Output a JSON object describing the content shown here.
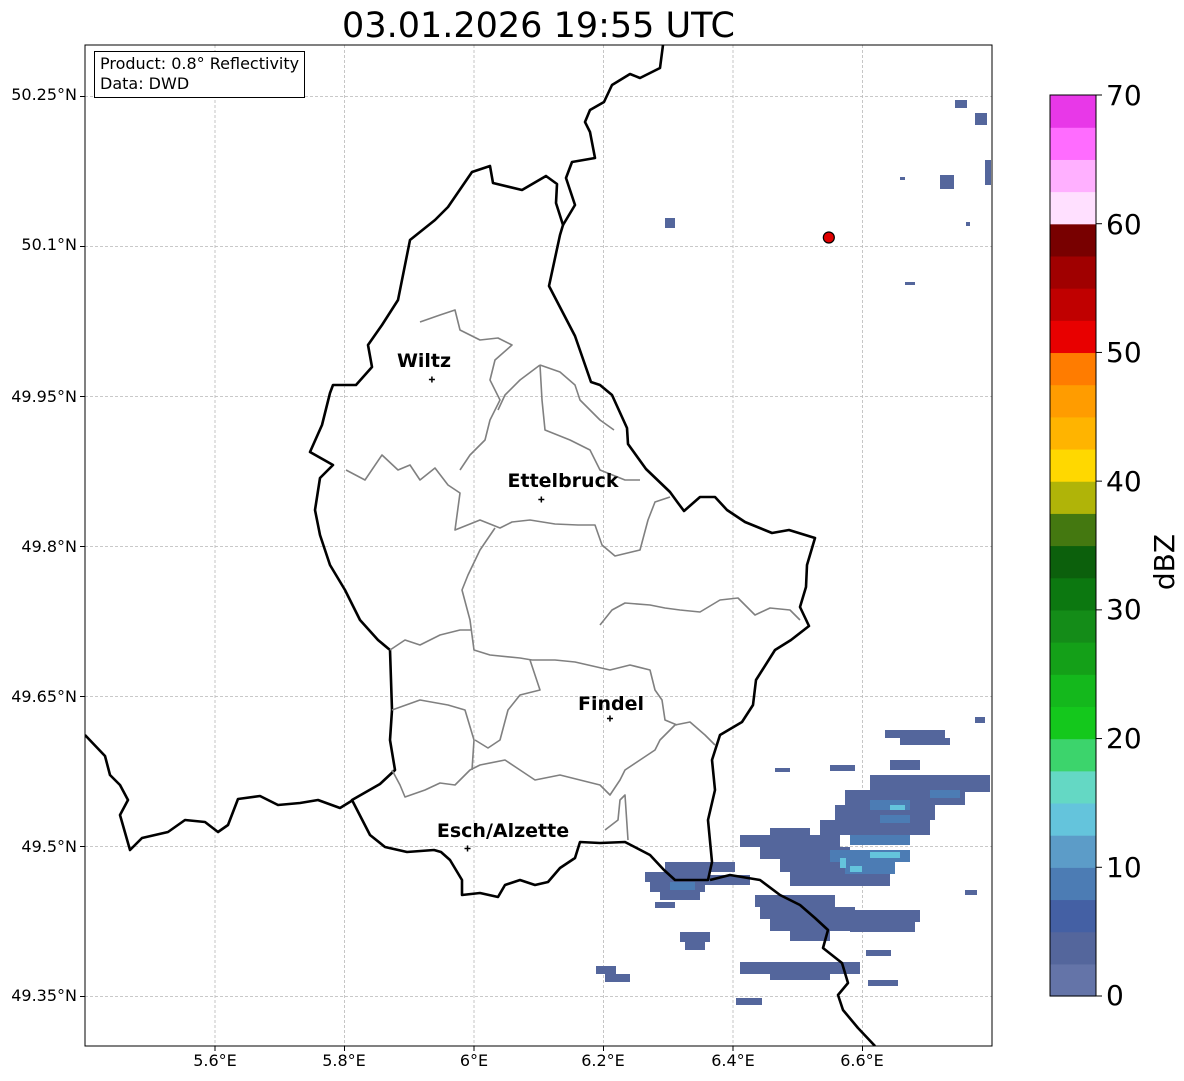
{
  "title": "03.01.2026 19:55 UTC",
  "info_box": {
    "product": "Product: 0.8° Reflectivity",
    "source": "Data: DWD"
  },
  "axes": {
    "lat_ticks": [
      "50.25°N",
      "50.1°N",
      "49.95°N",
      "49.8°N",
      "49.65°N",
      "49.5°N",
      "49.35°N"
    ],
    "lon_ticks": [
      "5.6°E",
      "5.8°E",
      "6°E",
      "6.2°E",
      "6.4°E",
      "6.6°E"
    ]
  },
  "cities": [
    {
      "name": "Wiltz",
      "lon": 5.935,
      "lat": 49.967
    },
    {
      "name": "Ettelbruck",
      "lon": 6.104,
      "lat": 49.847
    },
    {
      "name": "Findel",
      "lon": 6.21,
      "lat": 49.628
    },
    {
      "name": "Esch/Alzette",
      "lon": 5.99,
      "lat": 49.498
    }
  ],
  "radar_site": {
    "lon": 6.548,
    "lat": 50.109,
    "color": "#e00000"
  },
  "colorbar": {
    "label": "dBZ",
    "ticks": [
      "0",
      "10",
      "20",
      "30",
      "40",
      "50",
      "60",
      "70"
    ],
    "colors": [
      "#6474a8",
      "#54669c",
      "#4460a4",
      "#4c7cb4",
      "#5c9cc8",
      "#64c4dc",
      "#64d8c4",
      "#3cd46c",
      "#14c81c",
      "#14b81c",
      "#14a018",
      "#148c18",
      "#0c7810",
      "#0c600c",
      "#447810",
      "#b0b408",
      "#ffd800",
      "#ffb400",
      "#ff9c00",
      "#ff7c00",
      "#e80000",
      "#c00000",
      "#a00000",
      "#780000",
      "#ffe0ff",
      "#ffb0ff",
      "#ff6cff",
      "#e838e8"
    ]
  }
}
